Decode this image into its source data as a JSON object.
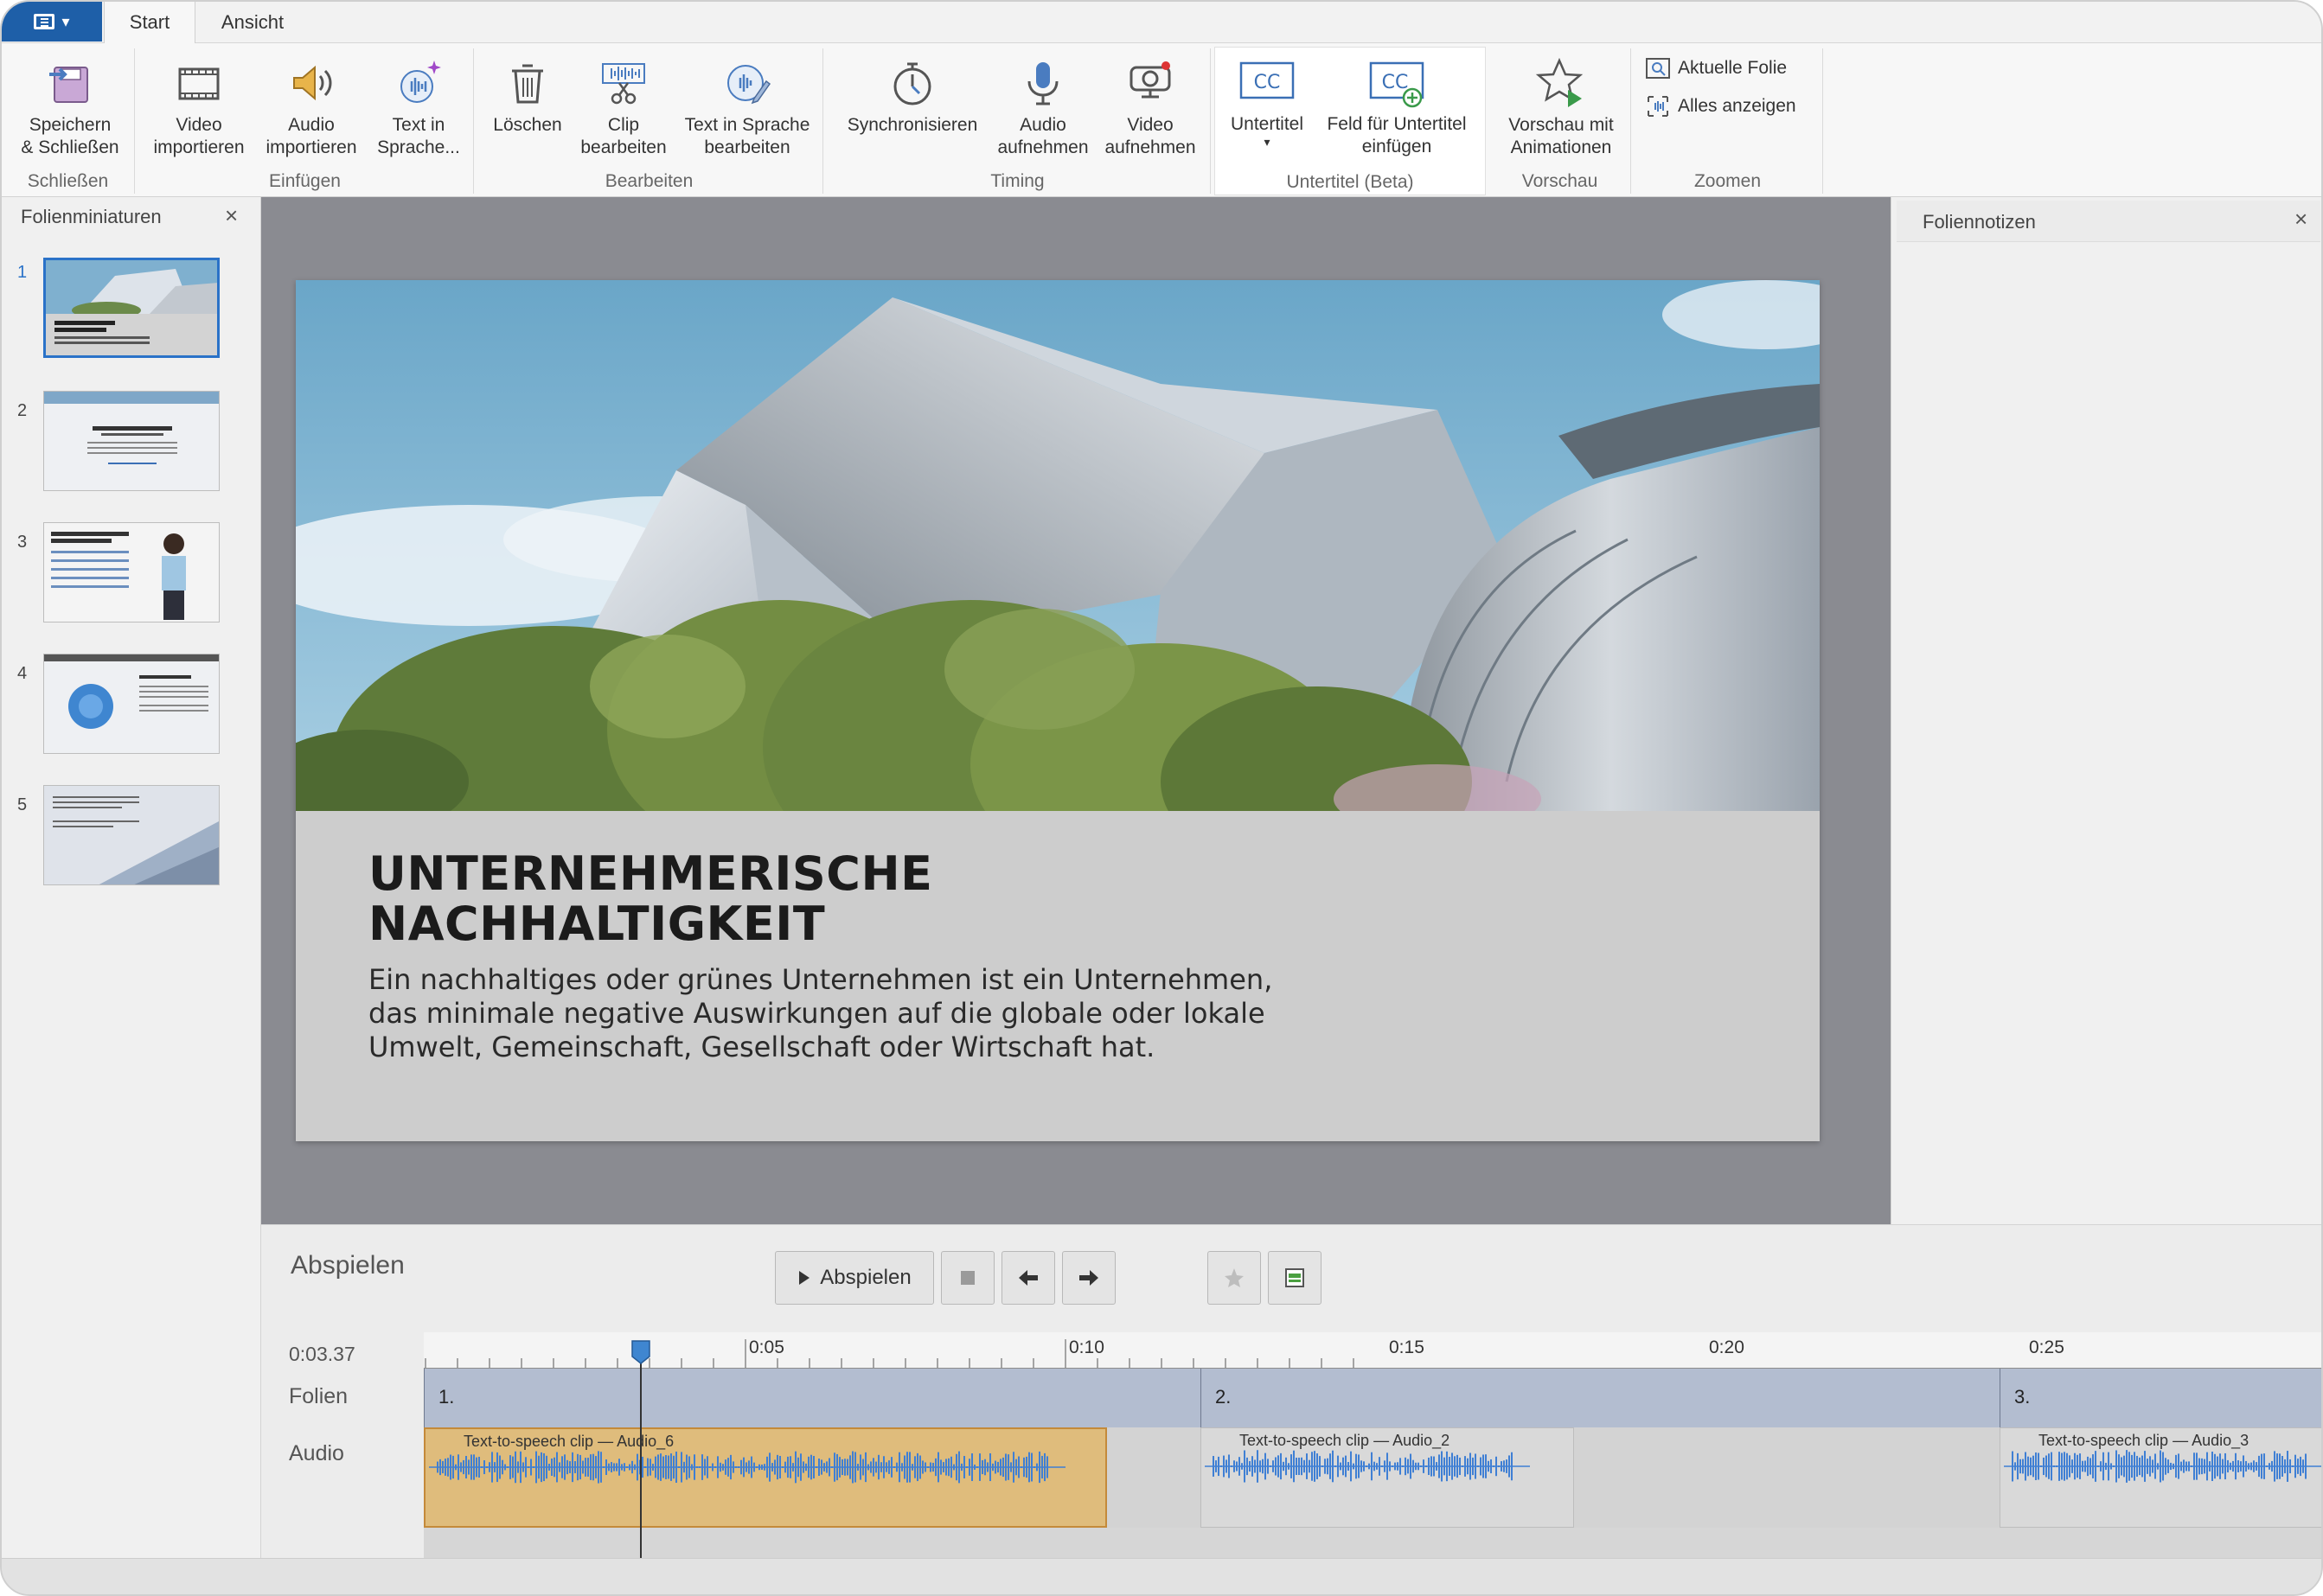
{
  "tabs": {
    "start": "Start",
    "ansicht": "Ansicht"
  },
  "ribbon": {
    "save_close": "Speichern\n& Schließen",
    "group_schliessen": "Schließen",
    "video_import": "Video\nimportieren",
    "audio_import": "Audio\nimportieren",
    "text_to_speech": "Text in\nSprache...",
    "group_einfuegen": "Einfügen",
    "delete": "Löschen",
    "clip_edit": "Clip\nbearbeiten",
    "tts_edit": "Text in Sprache\nbearbeiten",
    "group_bearbeiten": "Bearbeiten",
    "sync": "Synchronisieren",
    "audio_record": "Audio\naufnehmen",
    "video_record": "Video\naufnehmen",
    "group_timing": "Timing",
    "subtitles": "Untertitel",
    "subtitle_field": "Feld für Untertitel\neinfügen",
    "group_subtitles": "Untertitel (Beta)",
    "preview_anim": "Vorschau mit\nAnimationen",
    "group_preview": "Vorschau",
    "current_slide": "Aktuelle Folie",
    "show_all": "Alles anzeigen",
    "group_zoom": "Zoomen"
  },
  "left_pane": {
    "title": "Folienminiaturen",
    "close": "×",
    "slides": [
      "1",
      "2",
      "3",
      "4",
      "5"
    ]
  },
  "slide": {
    "title": "UNTERNEHMERISCHE\nNACHHALTIGKEIT",
    "body": "Ein nachhaltiges oder grünes Unternehmen ist ein Unternehmen,\ndas minimale negative Auswirkungen auf die globale oder lokale\nUmwelt, Gemeinschaft, Gesellschaft oder Wirtschaft hat."
  },
  "right_pane": {
    "title": "Foliennotizen",
    "close": "×"
  },
  "playback": {
    "title": "Abspielen",
    "play_label": "Abspielen",
    "time": "0:03.37",
    "row_slides": "Folien",
    "row_audio": "Audio",
    "ruler_labels": [
      "0:05",
      "0:10",
      "0:15",
      "0:20",
      "0:25"
    ],
    "slide_segments": [
      "1.",
      "2.",
      "3."
    ],
    "clips": [
      "Text-to-speech clip — Audio_6",
      "Text-to-speech clip — Audio_2",
      "Text-to-speech clip — Audio_3"
    ],
    "playhead_seconds": 3.37
  },
  "colors": {
    "accent": "#1e5fa8",
    "selection": "#2a72c8",
    "active_clip": "#dfbc7c",
    "waveform": "#3f7fd4"
  }
}
